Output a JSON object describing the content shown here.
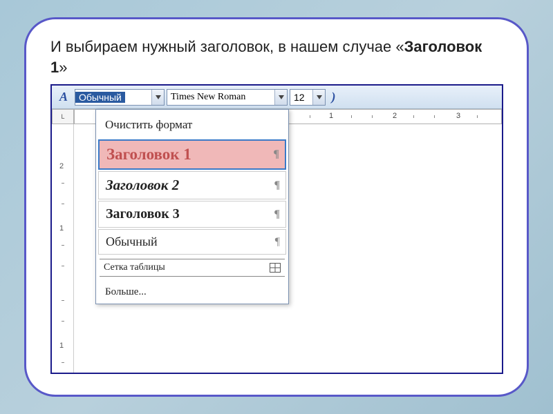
{
  "instruction": {
    "prefix": "    И выбираем нужный заголовок, в нашем случае «",
    "bold": "Заголовок 1",
    "suffix": "»"
  },
  "toolbar": {
    "style_value": "Обычный",
    "font_value": "Times New Roman",
    "size_value": "12"
  },
  "ruler": {
    "h_marks": [
      "1",
      "2",
      "3"
    ],
    "v_marks": [
      "2",
      "1",
      "1"
    ]
  },
  "dropdown": {
    "clear": "Очистить формат",
    "h1": "Заголовок 1",
    "h2": "Заголовок 2",
    "h3": "Заголовок 3",
    "normal": "Обычный",
    "grid": "Сетка таблицы",
    "more": "Больше..."
  }
}
